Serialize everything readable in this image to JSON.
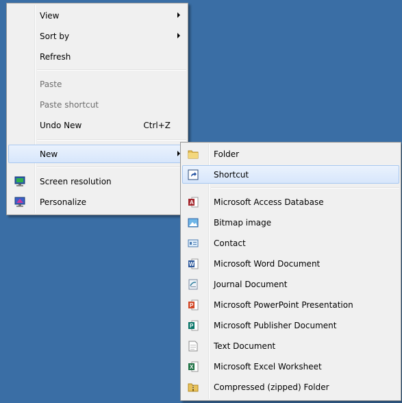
{
  "context_menu": {
    "items": [
      {
        "label": "View"
      },
      {
        "label": "Sort by"
      },
      {
        "label": "Refresh"
      },
      {
        "label": "Paste"
      },
      {
        "label": "Paste shortcut"
      },
      {
        "label": "Undo New",
        "shortcut": "Ctrl+Z"
      },
      {
        "label": "New"
      },
      {
        "label": "Screen resolution",
        "icon": "screen-resolution-icon"
      },
      {
        "label": "Personalize",
        "icon": "personalize-icon"
      }
    ]
  },
  "new_submenu": {
    "items": [
      {
        "label": "Folder",
        "icon": "folder-icon"
      },
      {
        "label": "Shortcut",
        "icon": "shortcut-icon"
      },
      {
        "label": "Microsoft Access Database",
        "icon": "access-icon"
      },
      {
        "label": "Bitmap image",
        "icon": "bitmap-icon"
      },
      {
        "label": "Contact",
        "icon": "contact-icon"
      },
      {
        "label": "Microsoft Word Document",
        "icon": "word-icon"
      },
      {
        "label": "Journal Document",
        "icon": "journal-icon"
      },
      {
        "label": "Microsoft PowerPoint Presentation",
        "icon": "powerpoint-icon"
      },
      {
        "label": "Microsoft Publisher Document",
        "icon": "publisher-icon"
      },
      {
        "label": "Text Document",
        "icon": "text-document-icon"
      },
      {
        "label": "Microsoft Excel Worksheet",
        "icon": "excel-icon"
      },
      {
        "label": "Compressed (zipped) Folder",
        "icon": "zip-folder-icon"
      }
    ]
  },
  "colors": {
    "desktop": "#3a6ea5",
    "menu_background": "#f0f0f0",
    "highlight": "#d7e6fb",
    "highlight_border": "#a8c8f0",
    "disabled_text": "#6d6d6d"
  }
}
